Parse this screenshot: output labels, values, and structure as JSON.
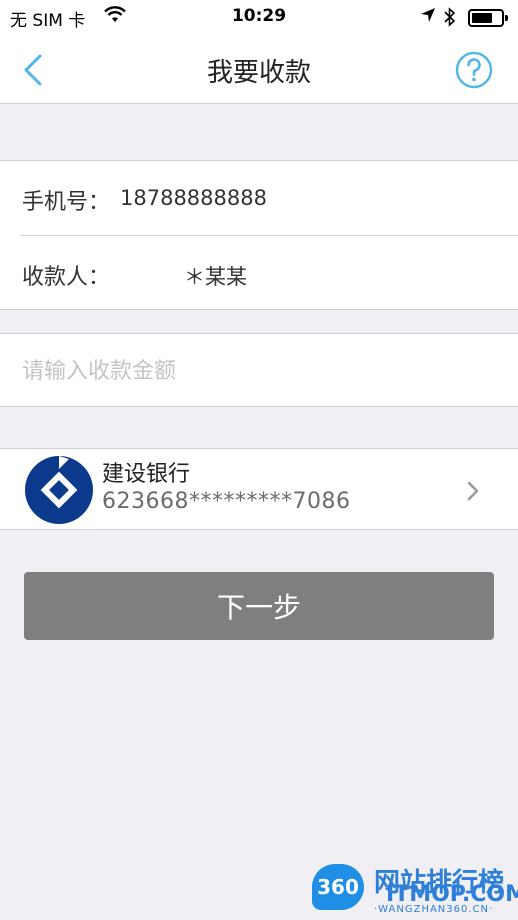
{
  "status_bar": {
    "carrier": "无 SIM 卡",
    "time": "10:29",
    "wifi_icon": "wifi-icon",
    "location_icon": "location-arrow-icon",
    "bluetooth_icon": "bluetooth-icon",
    "battery_icon": "battery-icon",
    "battery_level": 0.7
  },
  "nav": {
    "title": "我要收款",
    "back_icon": "chevron-left-icon",
    "help_icon": "question-circle-icon"
  },
  "info": {
    "phone_label": "手机号：",
    "phone_value": "18788888888",
    "payee_label": "收款人：",
    "payee_value": "＊某某"
  },
  "amount": {
    "placeholder": "请输入收款金额",
    "value": ""
  },
  "bank": {
    "name": "建设银行",
    "card_number": "623668*********7086",
    "logo_icon": "ccb-bank-logo-icon",
    "chevron_icon": "chevron-right-icon"
  },
  "actions": {
    "next_label": "下一步"
  },
  "watermark": {
    "badge": "360",
    "title": "网站排行榜",
    "subtitle": "ITMOP.COM",
    "url": "·WANGZHAN360.CN·"
  },
  "colors": {
    "accent": "#4fb6e8",
    "background": "#efeff4",
    "button": "#7f7f7f",
    "bank_blue": "#0b3a8c",
    "watermark_blue": "#2d7fd8"
  }
}
